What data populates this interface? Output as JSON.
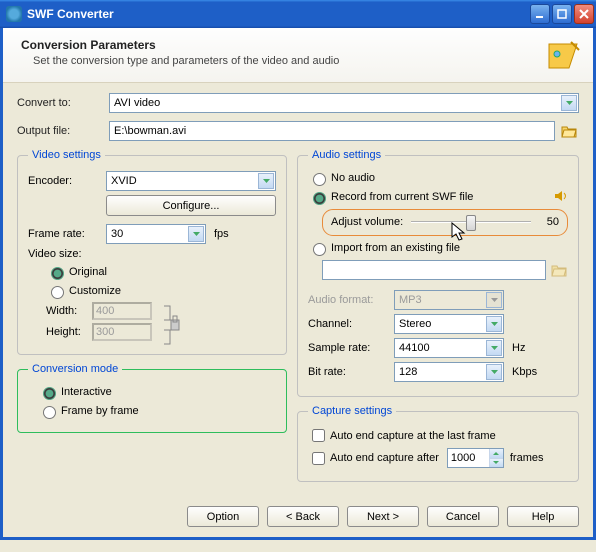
{
  "window": {
    "title": "SWF Converter"
  },
  "header": {
    "title": "Conversion Parameters",
    "subtitle": "Set the conversion type and parameters of the video and audio"
  },
  "convert_to": {
    "label": "Convert to:",
    "value": "AVI video"
  },
  "output_file": {
    "label": "Output file:",
    "value": "E:\\bowman.avi"
  },
  "video_settings": {
    "legend": "Video settings",
    "encoder_label": "Encoder:",
    "encoder_value": "XVID",
    "configure_btn": "Configure...",
    "frame_rate_label": "Frame rate:",
    "frame_rate_value": "30",
    "fps_unit": "fps",
    "video_size_label": "Video size:",
    "original_label": "Original",
    "customize_label": "Customize",
    "width_label": "Width:",
    "width_value": "400",
    "height_label": "Height:",
    "height_value": "300"
  },
  "audio_settings": {
    "legend": "Audio settings",
    "no_audio": "No audio",
    "record_swf": "Record from current SWF file",
    "adjust_volume_label": "Adjust volume:",
    "adjust_volume_value": "50",
    "import_existing": "Import from an existing file",
    "import_path": "",
    "audio_format_label": "Audio format:",
    "audio_format_value": "MP3",
    "channel_label": "Channel:",
    "channel_value": "Stereo",
    "sample_rate_label": "Sample rate:",
    "sample_rate_value": "44100",
    "sample_rate_unit": "Hz",
    "bit_rate_label": "Bit rate:",
    "bit_rate_value": "128",
    "bit_rate_unit": "Kbps"
  },
  "conversion_mode": {
    "legend": "Conversion mode",
    "interactive": "Interactive",
    "frame_by_frame": "Frame by frame"
  },
  "capture_settings": {
    "legend": "Capture settings",
    "auto_end_last": "Auto end capture at the last frame",
    "auto_end_after": "Auto end capture after",
    "auto_end_frames_value": "1000",
    "auto_end_frames_unit": "frames"
  },
  "buttons": {
    "option": "Option",
    "back": "< Back",
    "next": "Next >",
    "cancel": "Cancel",
    "help": "Help"
  }
}
